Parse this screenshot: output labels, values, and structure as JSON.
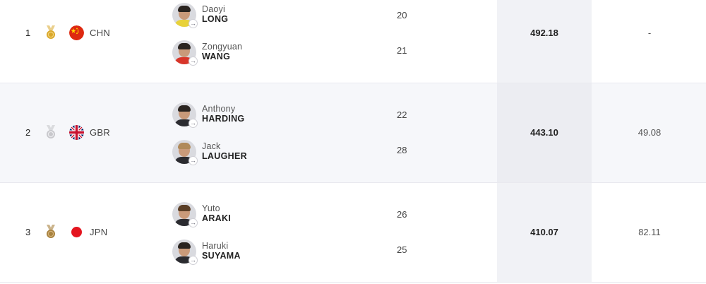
{
  "rows": [
    {
      "rank": "1",
      "medal": "gold-medal",
      "country": "CHN",
      "athletes": [
        {
          "first": "Daoyi",
          "last": "LONG",
          "age": "20"
        },
        {
          "first": "Zongyuan",
          "last": "WANG",
          "age": "21"
        }
      ],
      "score": "492.18",
      "behind": "-"
    },
    {
      "rank": "2",
      "medal": "silver-medal",
      "country": "GBR",
      "athletes": [
        {
          "first": "Anthony",
          "last": "HARDING",
          "age": "22"
        },
        {
          "first": "Jack",
          "last": "LAUGHER",
          "age": "28"
        }
      ],
      "score": "443.10",
      "behind": "49.08"
    },
    {
      "rank": "3",
      "medal": "bronze-medal",
      "country": "JPN",
      "athletes": [
        {
          "first": "Yuto",
          "last": "ARAKI",
          "age": "26"
        },
        {
          "first": "Haruki",
          "last": "SUYAMA",
          "age": "25"
        }
      ],
      "score": "410.07",
      "behind": "82.11"
    }
  ],
  "colors": {
    "gold": "#d9a82b",
    "silver": "#c8c8cc",
    "bronze": "#a8823f",
    "row_alt_bg": "#f6f7fa",
    "score_col_bg": "#f1f2f6"
  }
}
